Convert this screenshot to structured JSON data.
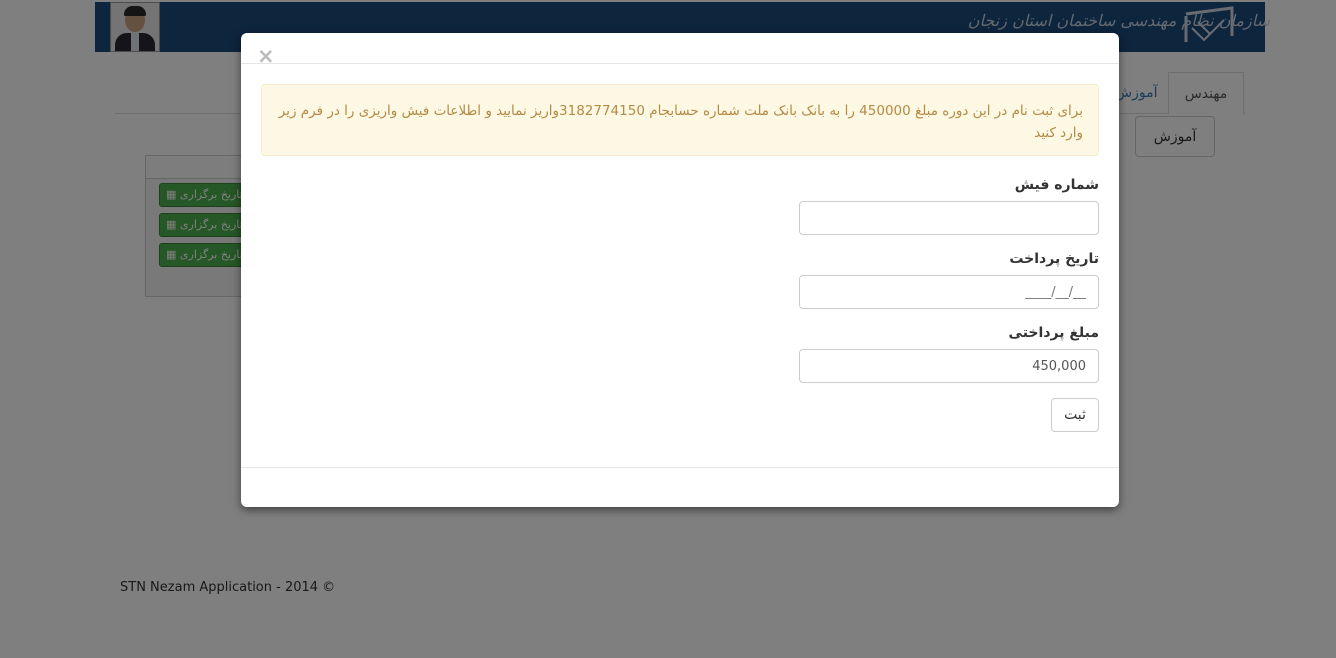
{
  "header": {
    "org_name": "سازمان نظام مهندسی ساختمان استان زنجان",
    "brand_color": "#1d4a7c"
  },
  "tabs": [
    {
      "label": "مهندس",
      "active": true
    },
    {
      "label": "آموزش",
      "active": false
    }
  ],
  "subnav": {
    "label": "آموزش"
  },
  "table": {
    "rows": [
      {
        "action_label": "تاریخ برگزاری",
        "icon": "calendar-icon"
      },
      {
        "action_label": "تاریخ برگزاری",
        "icon": "calendar-icon"
      },
      {
        "action_label": "تاریخ برگزاری",
        "icon": "calendar-icon"
      }
    ]
  },
  "footer": {
    "text": "STN Nezam Application - 2014 ©"
  },
  "modal": {
    "close_symbol": "×",
    "alert_text": "برای ثبت نام در این دوره مبلغ 450000 را به بانک بانک ملت شماره حسابجام 3182774150واریز نمایید و اطلاعات فیش واریزی را در فرم زیر وارد کنید",
    "fields": {
      "receipt_number": {
        "label": "شماره فیش",
        "value": ""
      },
      "payment_date": {
        "label": "تاریخ پرداخت",
        "value": "",
        "placeholder": "____/__/__"
      },
      "payment_amount": {
        "label": "مبلغ پرداختی",
        "value": "450,000"
      }
    },
    "submit_label": "ثبت",
    "alert_color": "#fcf8e3"
  }
}
